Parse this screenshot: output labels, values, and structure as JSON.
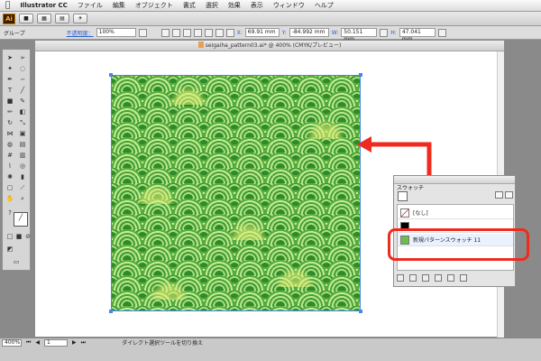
{
  "menubar": {
    "apple": "",
    "items": [
      "Illustrator CC",
      "ファイル",
      "編集",
      "オブジェクト",
      "書式",
      "選択",
      "効果",
      "表示",
      "ウィンドウ",
      "ヘルプ"
    ]
  },
  "appbar": {
    "logo": "Ai"
  },
  "controlbar": {
    "selection_label": "グループ",
    "opacity_label": "不透明度：",
    "opacity_value": "100%",
    "x_label": "X:",
    "x_value": "69.91 mm",
    "y_label": "Y:",
    "y_value": "-84.992 mm",
    "w_label": "W:",
    "w_value": "50.151 mm",
    "h_label": "H:",
    "h_value": "47.041 mm"
  },
  "document": {
    "title": "seigaiha_pattern03.ai* @ 400% (CMYK/プレビュー)"
  },
  "swatches": {
    "tab": "スウォッチ",
    "items": [
      {
        "label": "[なし]"
      },
      {
        "label": ""
      },
      {
        "label": "新規パターンスウォッチ 11"
      }
    ],
    "colors": {
      "pattern": "#6cbf4a",
      "registration": "#000000"
    }
  },
  "statusbar": {
    "zoom": "400%",
    "page": "1",
    "message": "ダイレクト選択ツールを切り換え"
  },
  "accent": {
    "highlight": "#ef2b1f",
    "selection": "#4a86e8"
  }
}
